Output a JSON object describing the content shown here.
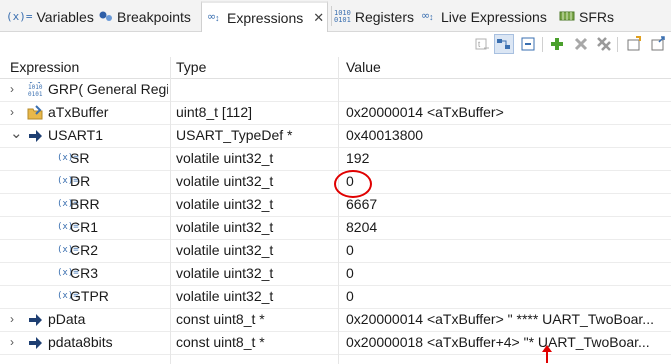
{
  "tabs": [
    {
      "label": "Variables",
      "icon": "variables-icon"
    },
    {
      "label": "Breakpoints",
      "icon": "breakpoints-icon"
    },
    {
      "label": "Expressions",
      "icon": "expressions-icon",
      "active": true,
      "close": "✕"
    },
    {
      "label": "Registers",
      "icon": "registers-icon"
    },
    {
      "label": "Live Expressions",
      "icon": "live-expressions-icon"
    },
    {
      "label": "SFRs",
      "icon": "sfrs-icon"
    }
  ],
  "toolbar": {
    "buttons": [
      "show-type-names-icon",
      "show-logical-structure-icon",
      "collapse-all-icon",
      "add-expression-icon",
      "remove-expression-icon",
      "remove-all-expressions-icon",
      "new-view-icon",
      "view-menu-icon"
    ]
  },
  "columns": {
    "expression": "Expression",
    "type": "Type",
    "value": "Value"
  },
  "rows": [
    {
      "expand": "›",
      "icon": "register-group-icon",
      "name": "GRP( General Regi",
      "type": "",
      "value": ""
    },
    {
      "expand": "›",
      "icon": "array-icon",
      "name": "aTxBuffer",
      "type": "uint8_t [112]",
      "value": "0x20000014 <aTxBuffer>"
    },
    {
      "expand": "⌄",
      "icon": "pointer-icon",
      "name": "USART1",
      "type": "USART_TypeDef *",
      "value": "0x40013800"
    },
    {
      "expand": "",
      "icon": "field-icon",
      "name": "SR",
      "type": "volatile uint32_t",
      "value": "192"
    },
    {
      "expand": "",
      "icon": "field-icon",
      "name": "DR",
      "type": "volatile uint32_t",
      "value": "0"
    },
    {
      "expand": "",
      "icon": "field-icon",
      "name": "BRR",
      "type": "volatile uint32_t",
      "value": "6667"
    },
    {
      "expand": "",
      "icon": "field-icon",
      "name": "CR1",
      "type": "volatile uint32_t",
      "value": "8204"
    },
    {
      "expand": "",
      "icon": "field-icon",
      "name": "CR2",
      "type": "volatile uint32_t",
      "value": "0"
    },
    {
      "expand": "",
      "icon": "field-icon",
      "name": "CR3",
      "type": "volatile uint32_t",
      "value": "0"
    },
    {
      "expand": "",
      "icon": "field-icon",
      "name": "GTPR",
      "type": "volatile uint32_t",
      "value": "0"
    },
    {
      "expand": "›",
      "icon": "pointer-icon",
      "name": "pData",
      "type": "const uint8_t *",
      "value": "0x20000014 <aTxBuffer> \" **** UART_TwoBoar..."
    },
    {
      "expand": "›",
      "icon": "pointer-icon",
      "name": "pdata8bits",
      "type": "const uint8_t *",
      "value": "0x20000018 <aTxBuffer+4> \"* UART_TwoBoar..."
    }
  ],
  "field_glyph": "(x)=",
  "annotation_color": "#e00000"
}
